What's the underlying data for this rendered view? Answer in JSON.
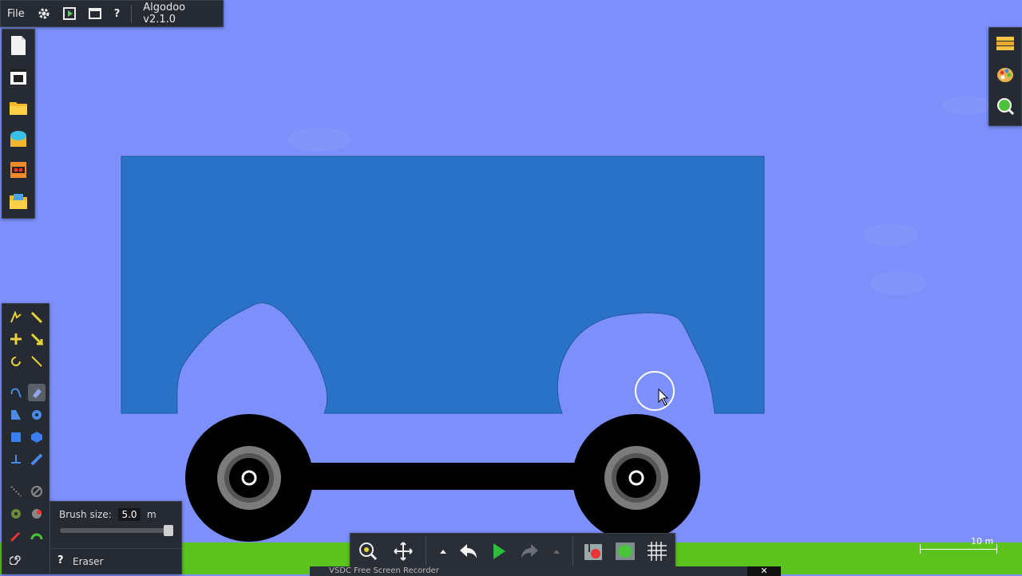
{
  "menu": {
    "file_label": "File",
    "version": "Algodoo v2.1.0"
  },
  "icons": {
    "settings": "gear-icon",
    "play_scene": "play-square-icon",
    "window": "window-icon",
    "help": "help-icon"
  },
  "brush": {
    "label": "Brush size:",
    "value": "5.0",
    "unit": "m",
    "slider_fraction": 1.0
  },
  "tool_name": {
    "help_glyph": "?",
    "label": "Eraser"
  },
  "scale_label": "10 m",
  "recorder_label": "VSDC Free Screen Recorder",
  "colors": {
    "sky": "#7c8ffb",
    "box": "#2a72c8",
    "ground": "#5bc31b",
    "wheel": "#000000",
    "panel": "#262a33"
  }
}
